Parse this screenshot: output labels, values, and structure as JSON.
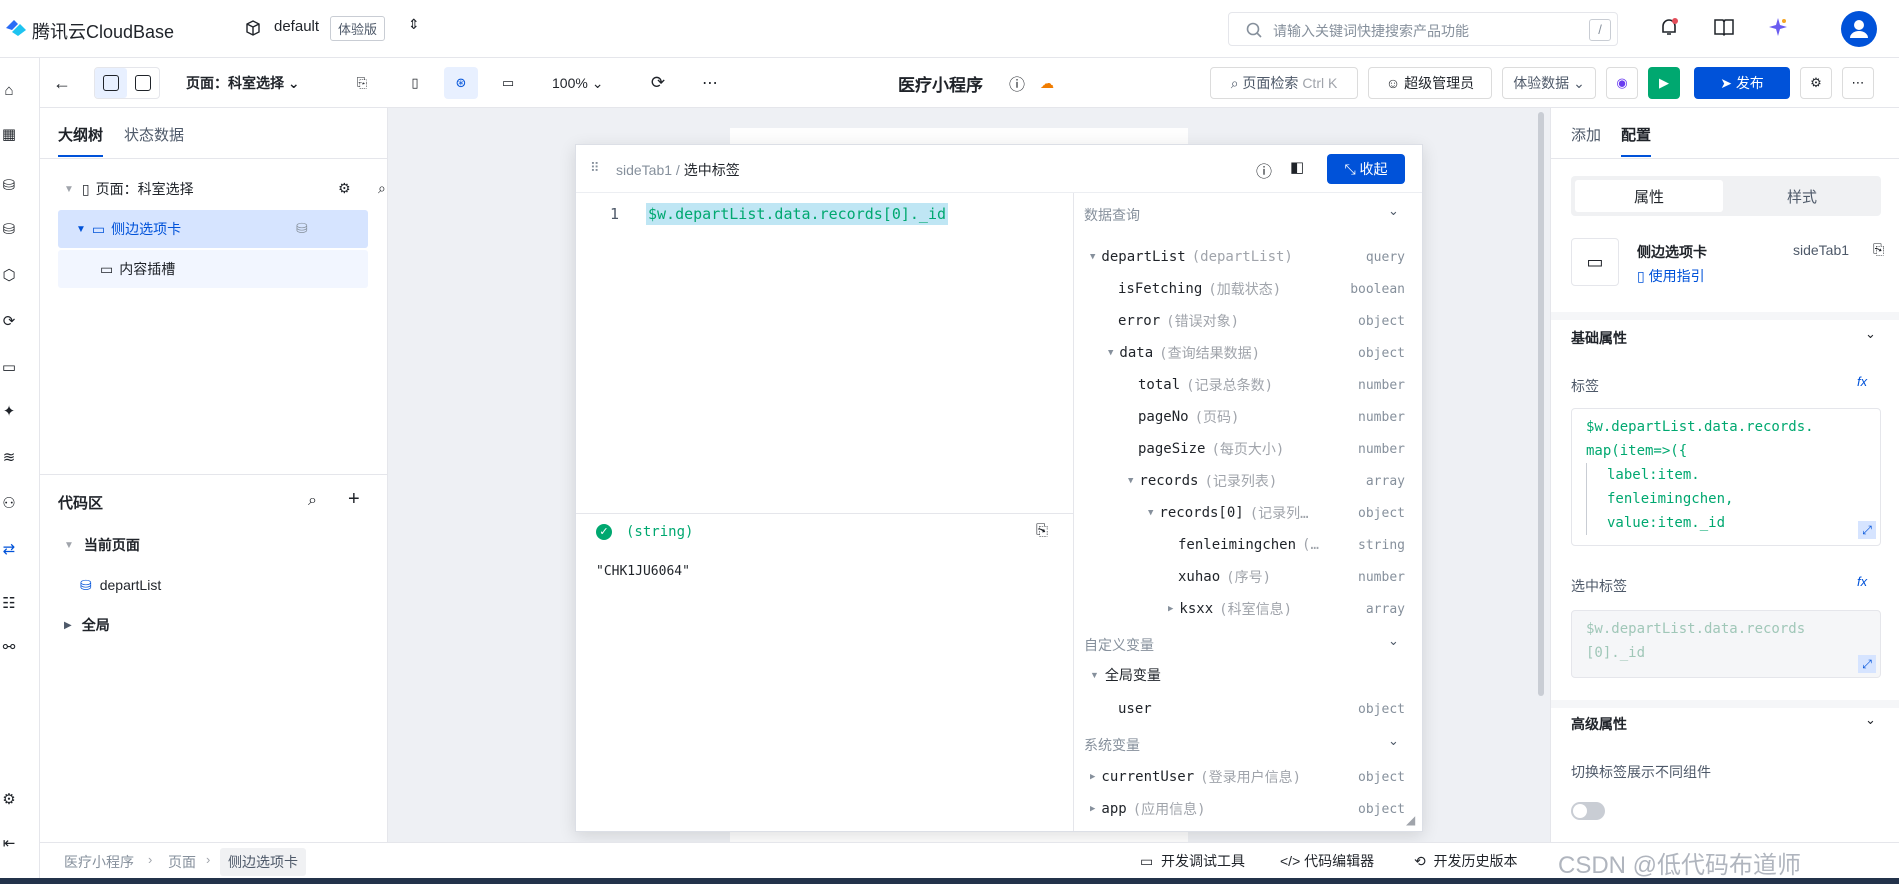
{
  "topbar": {
    "brand": "腾讯云CloudBase",
    "env_name": "default",
    "env_badge": "体验版",
    "search_placeholder": "请输入关键词快捷搜索产品功能",
    "search_shortcut": "/"
  },
  "toolbar": {
    "page_select": "页面：科室选择",
    "zoom": "100%",
    "app_title": "医疗小程序",
    "page_search": "页面检索",
    "page_search_shortcut": "Ctrl K",
    "role": "超级管理员",
    "data_mode": "体验数据",
    "publish": "发布"
  },
  "left": {
    "tabs": [
      "大纲树",
      "状态数据"
    ],
    "tree": [
      {
        "label": "页面：科室选择"
      },
      {
        "label": "侧边选项卡"
      },
      {
        "label": "内容插槽"
      }
    ],
    "code_title": "代码区",
    "code_groups": [
      {
        "label": "当前页面"
      },
      {
        "label": "departList"
      },
      {
        "label": "全局"
      }
    ]
  },
  "popup": {
    "crumb_parent": "sideTab1",
    "crumb_current": "选中标签",
    "collapse": "收起",
    "line_no": "1",
    "expression": "$w.departList.data.records[0]._id",
    "result_type": "(string)",
    "result_value": "\"CHK1JU6064\"",
    "sections": {
      "query": "数据查询",
      "custom": "自定义变量",
      "system": "系统变量"
    },
    "vars": [
      {
        "name": "departList",
        "desc": "(departList)",
        "type": "query"
      },
      {
        "name": "isFetching",
        "desc": "(加载状态)",
        "type": "boolean"
      },
      {
        "name": "error",
        "desc": "(错误对象)",
        "type": "object"
      },
      {
        "name": "data",
        "desc": "(查询结果数据)",
        "type": "object"
      },
      {
        "name": "total",
        "desc": "(记录总条数)",
        "type": "number"
      },
      {
        "name": "pageNo",
        "desc": "(页码)",
        "type": "number"
      },
      {
        "name": "pageSize",
        "desc": "(每页大小)",
        "type": "number"
      },
      {
        "name": "records",
        "desc": "(记录列表)",
        "type": "array"
      },
      {
        "name": "records[0]",
        "desc": "(记录列…",
        "type": "object"
      },
      {
        "name": "fenleimingchen",
        "desc": "(…",
        "type": "string"
      },
      {
        "name": "xuhao",
        "desc": "(序号)",
        "type": "number"
      },
      {
        "name": "ksxx",
        "desc": "(科室信息)",
        "type": "array"
      }
    ],
    "custom_vars": [
      {
        "name": "全局变量"
      },
      {
        "name": "user",
        "type": "object"
      }
    ],
    "system_vars": [
      {
        "name": "currentUser",
        "desc": "(登录用户信息)",
        "type": "object"
      },
      {
        "name": "app",
        "desc": "(应用信息)",
        "type": "object"
      }
    ]
  },
  "right": {
    "tabs": [
      "添加",
      "配置"
    ],
    "segments": [
      "属性",
      "样式"
    ],
    "component_name": "侧边选项卡",
    "component_id": "sideTab1",
    "guide": "使用指引",
    "basic_title": "基础属性",
    "label_field": "标签",
    "label_code": [
      "$w.departList.data.records.",
      "map(item=>({",
      "label:item.",
      "fenleimingchen,",
      "value:item._id"
    ],
    "selected_field": "选中标签",
    "selected_code": [
      "$w.departList.data.records",
      "[0]._id"
    ],
    "advanced_title": "高级属性",
    "switch_label": "切换标签展示不同组件"
  },
  "bottom": {
    "breadcrumb": [
      "医疗小程序",
      "页面",
      "侧边选项卡"
    ],
    "tools": [
      "开发调试工具",
      "代码编辑器",
      "开发历史版本"
    ],
    "watermark": "CSDN @低代码布道师"
  },
  "colors": {
    "primary": "#0052d9",
    "green": "#00a870",
    "highlight": "#bfe6f4"
  }
}
